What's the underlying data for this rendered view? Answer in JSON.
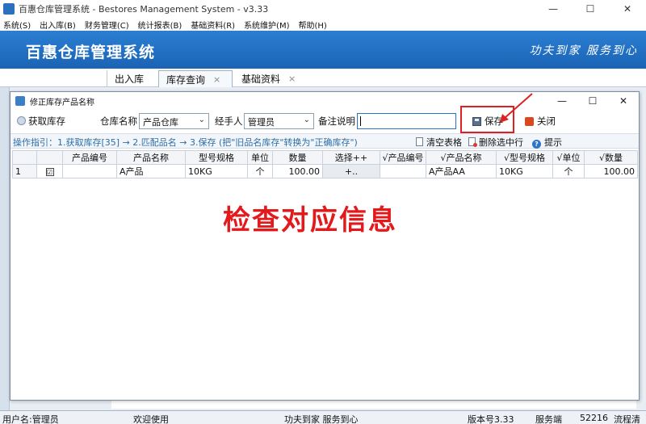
{
  "window": {
    "title": "百惠仓库管理系统 - Bestores Management System - v3.33",
    "minimize": "—",
    "maximize": "☐",
    "close": "✕"
  },
  "menu": [
    "系统(S)",
    "出入库(B)",
    "财务管理(C)",
    "统计报表(B)",
    "基础资料(R)",
    "系统维护(M)",
    "帮助(H)"
  ],
  "banner": {
    "title": "百惠仓库管理系统",
    "slogan": "功夫到家 服务到心"
  },
  "tabs": [
    {
      "label": "出入库",
      "active": false
    },
    {
      "label": "库存查询",
      "active": true,
      "close": "×"
    },
    {
      "label": "基础资料",
      "active": false,
      "close": "×"
    }
  ],
  "dialog": {
    "title": "修正库存产品名称",
    "minimize": "—",
    "maximize": "☐",
    "close": "✕",
    "toolbar": {
      "fetch_label": "获取库存",
      "warehouse_label": "仓库名称",
      "warehouse_value": "产品仓库",
      "handler_label": "经手人",
      "handler_value": "管理员",
      "remark_label": "备注说明",
      "remark_value": "",
      "save_label": "保存",
      "close_label": "关闭"
    },
    "guide": {
      "text": "操作指引：1.获取库存[35] → 2.匹配品名 → 3.保存 (把\"旧品名库存\"转换为\"正确库存\")",
      "clear_label": "清空表格",
      "delete_label": "删除选中行",
      "help_label": "提示"
    },
    "table": {
      "columns": [
        "",
        "",
        "产品编号",
        "产品名称",
        "型号规格",
        "单位",
        "数量",
        "选择++",
        "√产品编号",
        "√产品名称",
        "√型号规格",
        "√单位",
        "√数量"
      ],
      "rows": [
        {
          "row_no": "1",
          "checked": "☑",
          "code": "",
          "name": "A产品",
          "spec": "10KG",
          "unit": "个",
          "qty": "100.00",
          "select": "+..",
          "new_code": "",
          "new_name": "A产品AA",
          "new_spec": "10KG",
          "new_unit": "个",
          "new_qty": "100.00"
        }
      ]
    },
    "annotation": "检查对应信息"
  },
  "status": {
    "user": "用户名:管理员",
    "welcome": "欢迎使用",
    "slogan": "功夫到家 服务到心",
    "version": "版本号3.33",
    "server": "服务端",
    "port": "52216",
    "flow": "流程清"
  },
  "colors": {
    "banner": "#1f6fc5",
    "annotation": "#e3191b",
    "highlight": "#e02020"
  }
}
